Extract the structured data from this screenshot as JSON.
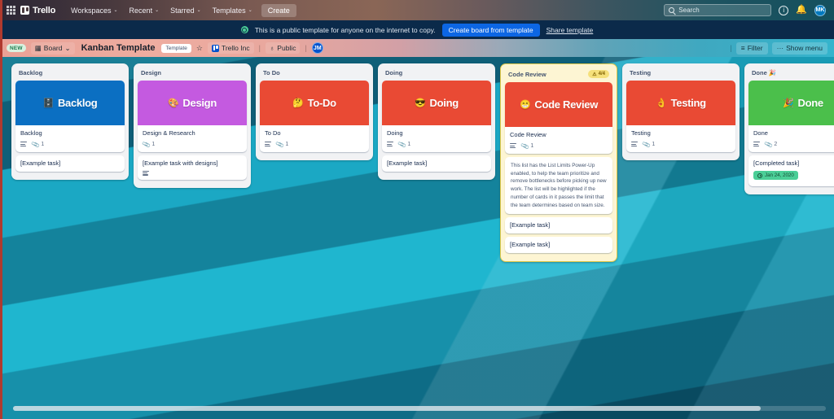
{
  "topnav": {
    "apps_icon": "grid-apps-icon",
    "brand": "Trello",
    "items": [
      {
        "label": "Workspaces",
        "caret": "⌄"
      },
      {
        "label": "Recent",
        "caret": "⌄"
      },
      {
        "label": "Starred",
        "caret": "⌄"
      },
      {
        "label": "Templates",
        "caret": "⌄"
      }
    ],
    "create_label": "Create",
    "search_placeholder": "Search",
    "info_glyph": "i",
    "bell_glyph": "\u0001",
    "avatar_initials": "MK"
  },
  "banner": {
    "message": "This is a public template for anyone on the internet to copy.",
    "primary_button": "Create board from template",
    "link": "Share template"
  },
  "board_header": {
    "new_badge": "NEW",
    "view_label": "Board",
    "view_caret": "⌄",
    "title": "Kanban Template",
    "template_badge": "Template",
    "star_glyph": "☆",
    "workspace": "Trello Inc",
    "visibility": "Public",
    "visibility_glyph": "♁",
    "member_initials": "JM",
    "filter_label": "Filter",
    "filter_glyph": "≡",
    "menu_label": "Show menu",
    "menu_glyph": "···"
  },
  "lists": [
    {
      "name": "Backlog",
      "wip": null,
      "cover": {
        "emoji": "🗄️",
        "label": "Backlog",
        "color": "#0b6fc2"
      },
      "cards": [
        {
          "title": "Backlog",
          "desc_icon": true,
          "attachments": "1"
        },
        {
          "title": "[Example task]"
        }
      ]
    },
    {
      "name": "Design",
      "wip": null,
      "cover": {
        "emoji": "🎨",
        "label": "Design",
        "color": "#c45ae0"
      },
      "cards": [
        {
          "title": "Design & Research",
          "desc_icon": false,
          "attachments": "1"
        },
        {
          "title": "[Example task with designs]",
          "desc_icon": true
        }
      ]
    },
    {
      "name": "To Do",
      "wip": null,
      "cover": {
        "emoji": "🤔",
        "label": "To-Do",
        "color": "#e94a34"
      },
      "cards": [
        {
          "title": "To Do",
          "desc_icon": true,
          "attachments": "1"
        }
      ]
    },
    {
      "name": "Doing",
      "wip": null,
      "cover": {
        "emoji": "😎",
        "label": "Doing",
        "color": "#e94a34"
      },
      "cards": [
        {
          "title": "Doing",
          "desc_icon": true,
          "attachments": "1"
        },
        {
          "title": "[Example task]"
        }
      ]
    },
    {
      "name": "Code Review",
      "wip": "4/4",
      "wip_glyph": "⚠",
      "cover": {
        "emoji": "😁",
        "label": "Code Review",
        "color": "#e94a34"
      },
      "cards": [
        {
          "title": "Code Review",
          "desc_icon": true,
          "attachments": "1"
        },
        {
          "description": "This list has the List Limits Power-Up enabled, to help the team prioritize and remove bottlenecks before picking up new work. The list will be highlighted if the number of cards in it passes the limit that the team determines based on team size."
        },
        {
          "title": "[Example task]"
        },
        {
          "title": "[Example task]"
        }
      ]
    },
    {
      "name": "Testing",
      "wip": null,
      "cover": {
        "emoji": "👌",
        "label": "Testing",
        "color": "#e94a34"
      },
      "cards": [
        {
          "title": "Testing",
          "desc_icon": true,
          "attachments": "1"
        }
      ]
    },
    {
      "name": "Done 🎉",
      "wip": null,
      "cover": {
        "emoji": "🎉",
        "label": "Done",
        "color": "#4bbf4b"
      },
      "cards": [
        {
          "title": "Done",
          "desc_icon": true,
          "attachments": "2"
        },
        {
          "title": "[Completed task]",
          "due": "Jan 24, 2020"
        }
      ]
    }
  ]
}
